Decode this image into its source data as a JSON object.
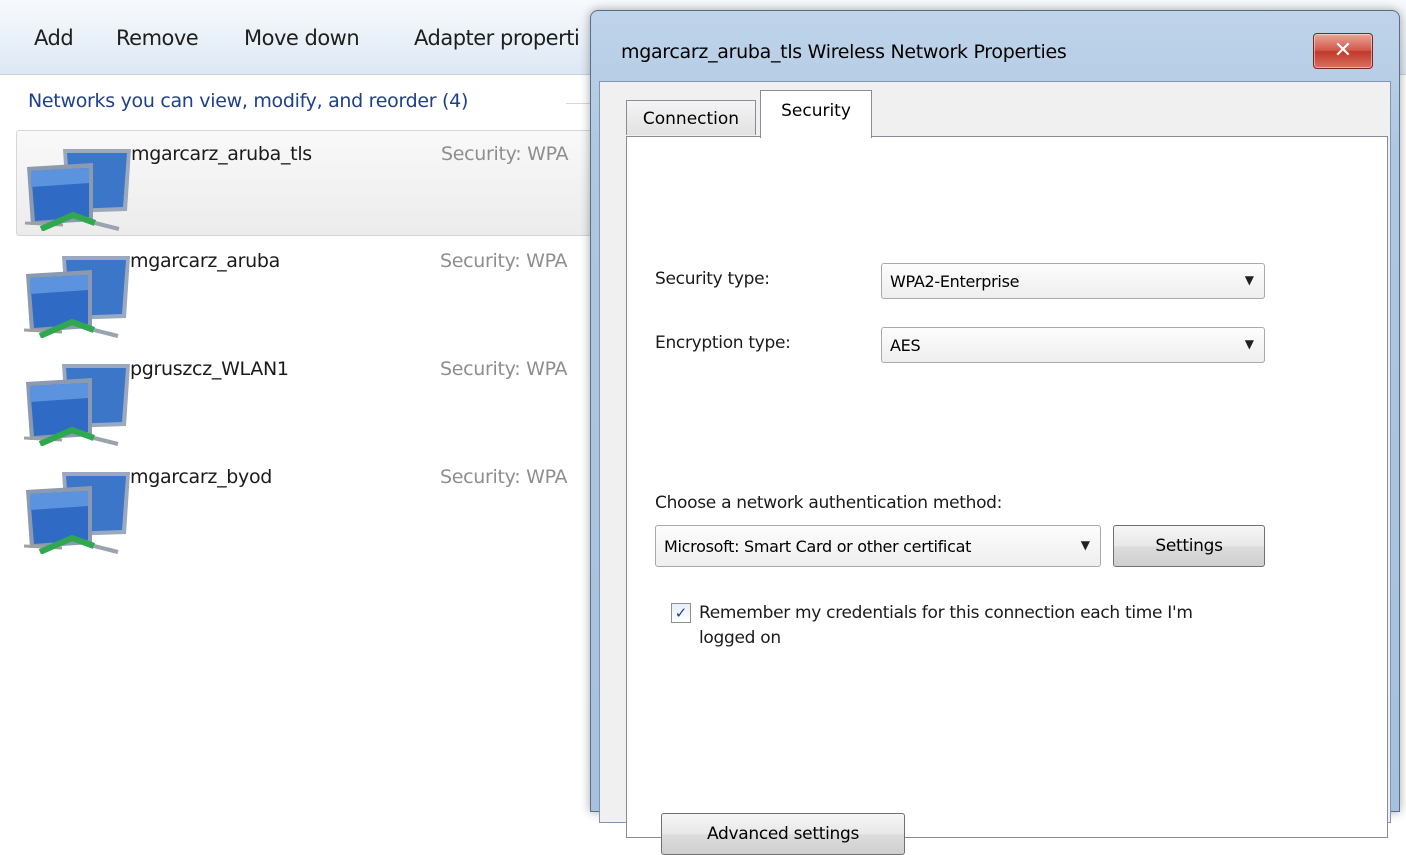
{
  "toolbar": {
    "add": "Add",
    "remove": "Remove",
    "move_down": "Move down",
    "adapter_properties": "Adapter properti"
  },
  "network_list": {
    "header": "Networks you can view, modify, and reorder (4)",
    "items": [
      {
        "name": "mgarcarz_aruba_tls",
        "security": "Security: WPA",
        "selected": true
      },
      {
        "name": "mgarcarz_aruba",
        "security": "Security: WPA",
        "selected": false
      },
      {
        "name": "pgruszcz_WLAN1",
        "security": "Security: WPA",
        "selected": false
      },
      {
        "name": "mgarcarz_byod",
        "security": "Security: WPA",
        "selected": false
      }
    ]
  },
  "dialog": {
    "title": "mgarcarz_aruba_tls Wireless Network Properties",
    "close_glyph": "✕",
    "tabs": [
      {
        "label": "Connection",
        "active": false
      },
      {
        "label": "Security",
        "active": true
      }
    ],
    "security": {
      "security_type_label": "Security type:",
      "security_type_value": "WPA2-Enterprise",
      "encryption_type_label": "Encryption type:",
      "encryption_type_value": "AES",
      "auth_method_label": "Choose a network authentication method:",
      "auth_method_value": "Microsoft: Smart Card or other certificat",
      "settings_button": "Settings",
      "remember_checked": true,
      "remember_label": "Remember my credentials for this connection each time I'm logged on",
      "advanced_button": "Advanced settings"
    }
  },
  "colors": {
    "group_header": "#1e3f8a",
    "close_button": "#c0392b",
    "dialog_frame": "#a6c1de",
    "cable_green": "#2fa84f"
  },
  "icons": {
    "network": "wireless-network-icon",
    "dropdown": "chevron-down-icon",
    "check": "checkmark-icon",
    "close": "close-icon"
  }
}
